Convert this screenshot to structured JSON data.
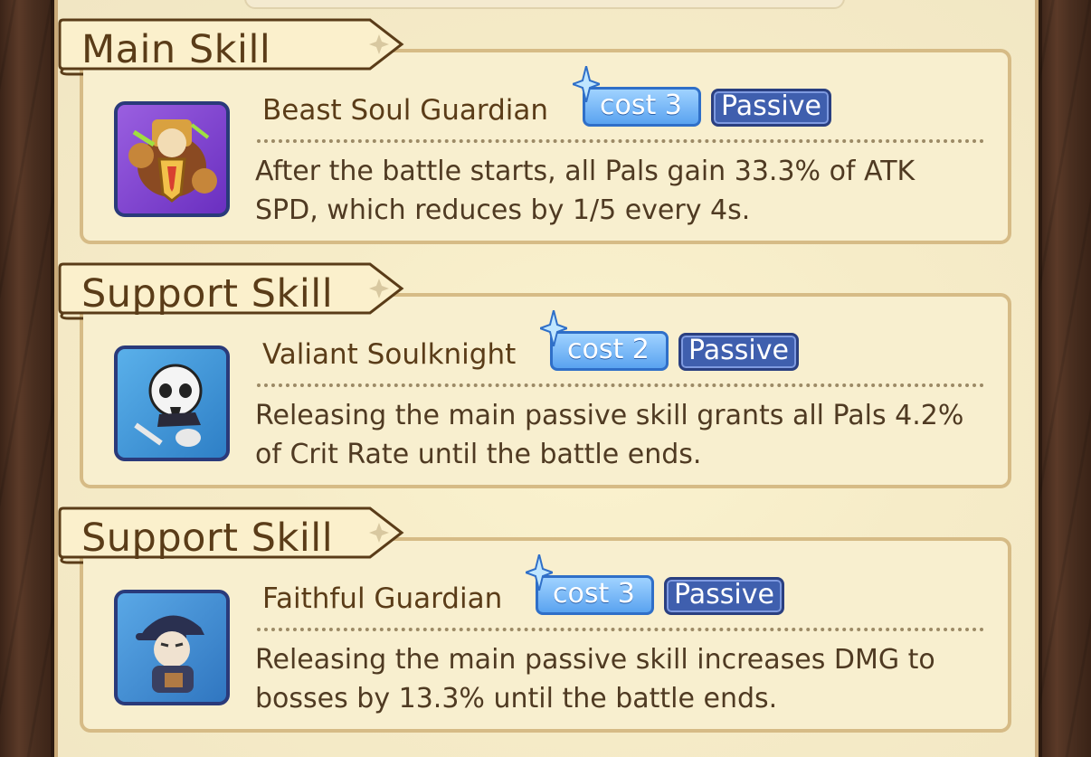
{
  "colors": {
    "parchment": "#f8efcf",
    "text_brown": "#5a3c18",
    "cost_blue": "#5aa3f0",
    "passive_navy": "#3f5fae"
  },
  "skills": [
    {
      "section_title": "Main Skill",
      "name": "Beast Soul Guardian",
      "cost": "cost 3",
      "type": "Passive",
      "description": "After the battle starts, all Pals gain 33.3% of ATK SPD, which reduces by 1/5 every 4s.",
      "icon": "beast-guardian-portrait"
    },
    {
      "section_title": "Support Skill",
      "name": "Valiant Soulknight",
      "cost": "cost 2",
      "type": "Passive",
      "description": "Releasing the main passive skill grants all Pals 4.2% of Crit Rate until the battle ends.",
      "icon": "skull-knight-portrait"
    },
    {
      "section_title": "Support Skill",
      "name": "Faithful Guardian",
      "cost": "cost 3",
      "type": "Passive",
      "description": "Releasing the main passive skill increases DMG to bosses by 13.3% until the battle ends.",
      "icon": "capped-courier-portrait"
    }
  ]
}
